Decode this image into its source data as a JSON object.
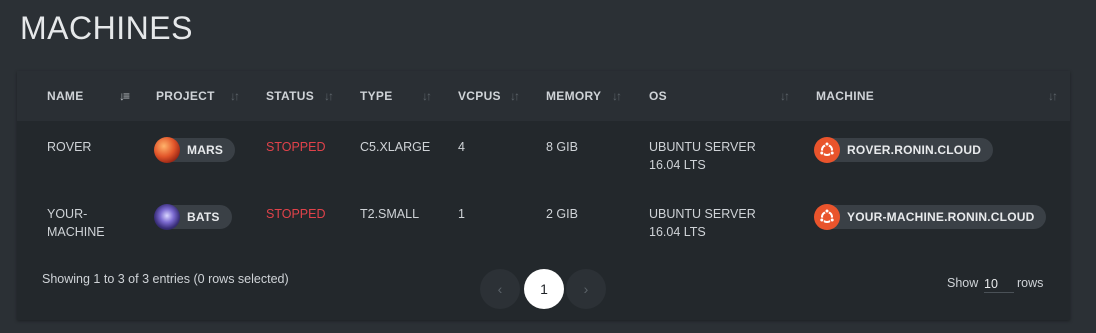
{
  "page": {
    "title": "MACHINES"
  },
  "table": {
    "columns": [
      {
        "label": "NAME"
      },
      {
        "label": "PROJECT"
      },
      {
        "label": "STATUS"
      },
      {
        "label": "TYPE"
      },
      {
        "label": "VCPUS"
      },
      {
        "label": "MEMORY"
      },
      {
        "label": "OS"
      },
      {
        "label": "MACHINE"
      }
    ],
    "rows": [
      {
        "name_line1": "ROVER",
        "name_line2": "",
        "project": "MARS",
        "project_icon": "mars-planet-icon",
        "status": "STOPPED",
        "type": "C5.XLARGE",
        "vcpus": "4",
        "memory": "8 GIB",
        "os_line1": "UBUNTU SERVER",
        "os_line2": "16.04 LTS",
        "machine": "ROVER.RONIN.CLOUD",
        "machine_icon": "ubuntu-icon"
      },
      {
        "name_line1": "YOUR-",
        "name_line2": "MACHINE",
        "project": "BATS",
        "project_icon": "bats-nebula-icon",
        "status": "STOPPED",
        "type": "T2.SMALL",
        "vcpus": "1",
        "memory": "2 GIB",
        "os_line1": "UBUNTU SERVER",
        "os_line2": "16.04 LTS",
        "machine": "YOUR-MACHINE.RONIN.CLOUD",
        "machine_icon": "ubuntu-icon"
      }
    ]
  },
  "footer": {
    "info": "Showing 1 to 3 of 3 entries (0 rows selected)",
    "prev": "‹",
    "current_page": "1",
    "next": "›",
    "show_label": "Show",
    "page_size": "10",
    "rows_label": "rows"
  },
  "colors": {
    "background": "#2b3035",
    "card": "#23282c",
    "status_stopped": "#e0424a",
    "ubuntu": "#e9542c"
  }
}
